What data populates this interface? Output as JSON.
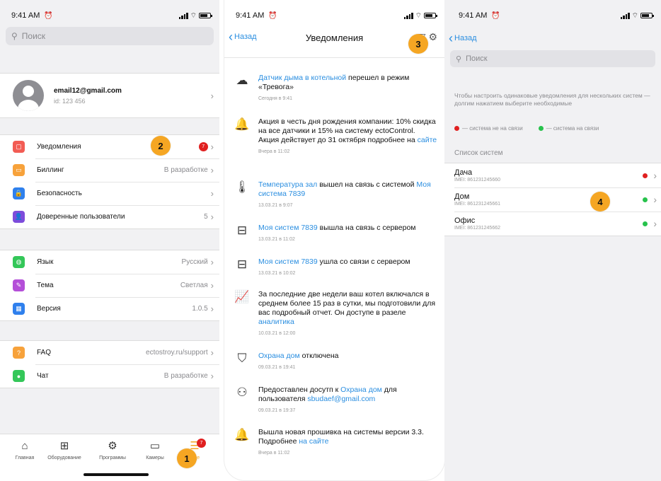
{
  "status": {
    "time": "9:41 AM"
  },
  "screen1": {
    "search_placeholder": "Поиск",
    "profile": {
      "email": "email12@gmail.com",
      "id": "id: 123 456"
    },
    "group1": [
      {
        "label": "Уведомления",
        "value": "",
        "badge": "7",
        "icon": "notification-icon",
        "color": "#f25c54"
      },
      {
        "label": "Биллинг",
        "value": "В разработке",
        "icon": "wallet-icon",
        "color": "#f7a23b"
      },
      {
        "label": "Безопасность",
        "value": "",
        "icon": "lock-icon",
        "color": "#2f80ed"
      },
      {
        "label": "Доверенные пользователи",
        "value": "5",
        "icon": "users-icon",
        "color": "#7d4cdb"
      }
    ],
    "group2": [
      {
        "label": "Язык",
        "value": "Русский",
        "icon": "globe-icon",
        "color": "#34c759"
      },
      {
        "label": "Тема",
        "value": "Светлая",
        "icon": "palette-icon",
        "color": "#b44fd8"
      },
      {
        "label": "Версия",
        "value": "1.0.5",
        "icon": "version-icon",
        "color": "#2f80ed"
      }
    ],
    "group3": [
      {
        "label": "FAQ",
        "value": "ectostroy.ru/support",
        "icon": "faq-icon",
        "color": "#f7a23b"
      },
      {
        "label": "Чат",
        "value": "В разработке",
        "icon": "chat-icon",
        "color": "#34c759"
      }
    ],
    "tabs": [
      {
        "label": "Главная",
        "icon": "home-icon"
      },
      {
        "label": "Оборудование",
        "icon": "equipment-icon"
      },
      {
        "label": "Программы",
        "icon": "programs-icon"
      },
      {
        "label": "Камеры",
        "icon": "camera-icon"
      },
      {
        "label": "Еще",
        "icon": "more-icon",
        "badge": "7"
      }
    ]
  },
  "screen2": {
    "back": "Назад",
    "title": "Уведомления",
    "notifications": [
      {
        "icon": "smoke-icon",
        "link": "Датчик дыма в котельной",
        "text": " перешел в режим «Тревога»",
        "time": "Сегодня в 9:41"
      },
      {
        "icon": "bell-icon",
        "text": "Акция в честь дня рождения компании: 10% скидка на все датчики и 15% на систему ectoControl. Акция действует до 31 октября подробнее на ",
        "link2": "сайте",
        "time": "Вчера в 11:02"
      },
      {
        "icon": "thermometer-icon",
        "link": "Температура зал",
        "text": " вышел на связь с системой ",
        "link2": "Моя система 7839",
        "time": "13.03.21 в 9:07"
      },
      {
        "icon": "controller-icon",
        "link": "Моя систем 7839",
        "text": " вышла на связь с сервером",
        "time": "13.03.21 в 11:02"
      },
      {
        "icon": "controller-icon",
        "link": "Моя систем 7839",
        "text": " ушла со связи с сервером",
        "time": "13.03.21 в 10:02"
      },
      {
        "icon": "analytics-icon",
        "text": "За последние две недели ваш котел включался в среднем более 15 раз в сутки, мы подготовили для вас подробный отчет. Он доступе в разеле ",
        "link2": "аналитика",
        "time": "10.03.21 в 12:00"
      },
      {
        "icon": "shield-icon",
        "link": "Охрана дом",
        "text": " отключена",
        "time": "09.03.21 в 19:41"
      },
      {
        "icon": "add-user-icon",
        "text": "Предоставлен досутп к ",
        "link2": "Охрана дом",
        "text2": " для пользователя ",
        "link3": "sbudaef@gmail.com",
        "time": "09.03.21 в 19:37"
      },
      {
        "icon": "bell-icon",
        "text": "Вышла новая прошивка на системы версии 3.3. Подробнее ",
        "link2": "на сайте",
        "time": "Вчера в 11:02"
      }
    ]
  },
  "screen3": {
    "back": "Назад",
    "search_placeholder": "Поиск",
    "hint": "Чтобы настроить одинаковые уведомления для нескольких систем — долгим нажатием выберите необходимые",
    "legend_offline": "— система не на связи",
    "legend_online": "— система на связи",
    "list_header": "Список систем",
    "colors": {
      "offline": "#e02020",
      "online": "#27c24c"
    },
    "systems": [
      {
        "name": "Дача",
        "imei": "IMEI: 861231245660",
        "status": "offline"
      },
      {
        "name": "Дом",
        "imei": "IMEI: 861231245661",
        "status": "online"
      },
      {
        "name": "Офис",
        "imei": "IMEI: 861231245662",
        "status": "online"
      }
    ]
  },
  "markers": [
    "1",
    "2",
    "3",
    "4"
  ]
}
